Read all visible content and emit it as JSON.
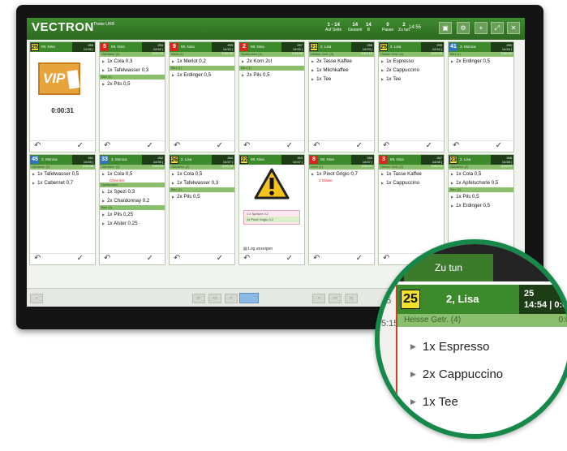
{
  "topbar": {
    "brand": "VECTRON",
    "brand_sub": "Theke\nUHR",
    "stats": [
      {
        "value": "1 - 14",
        "label": "Auf Seite"
      },
      {
        "value": "14",
        "label": "Gesamt"
      },
      {
        "value": "14",
        "label": "B"
      },
      {
        "value": "0",
        "label": "Pause"
      },
      {
        "value": "2",
        "label": "Zu tun"
      }
    ],
    "clock": "14:55"
  },
  "vip": {
    "badge": "VIP",
    "timer": "0:00:31"
  },
  "alert": {
    "messages": [
      "1 x Spritzer 0,2",
      "1x Pinot Grigio 0,2"
    ],
    "log_button": "Log anzeigen"
  },
  "tickets": [
    {
      "number": "25",
      "color": "y",
      "name": "Mt. Nina",
      "info1": "265",
      "info2": "14:56 | 0:00:31",
      "type": "vip"
    },
    {
      "number": "5",
      "color": "r",
      "name": "Mt. Nina",
      "info1": "254",
      "info2": "14:52 | 0:02:23",
      "groups": [
        {
          "label": "Getränke (2)",
          "items": [
            "1x Cola 0,3",
            "1x Tafelwasser 0,3"
          ]
        },
        {
          "label": "Bier (1)",
          "items": [
            "2x Pils 0,5"
          ]
        }
      ]
    },
    {
      "number": "9",
      "color": "r",
      "name": "Mt. Nina",
      "info1": "255",
      "info2": "14:52 | 0:02:08",
      "groups": [
        {
          "label": "Wein (1)",
          "items": [
            "1x Merlot 0,2"
          ]
        },
        {
          "label": "Bier (1)",
          "items": [
            "1x Erdinger 0,5"
          ]
        }
      ]
    },
    {
      "number": "2",
      "color": "r",
      "name": "Mt. Nina",
      "info1": "257",
      "info2": "14:53 | 0:01:46",
      "groups": [
        {
          "label": "Spirituosen (1)",
          "items": [
            "2x Korn 2cl"
          ]
        },
        {
          "label": "Bier (1)",
          "items": [
            "2x Pils 0,5"
          ]
        }
      ]
    },
    {
      "number": "21",
      "color": "y",
      "name": "2. Lisa",
      "info1": "258",
      "info2": "14:53 | 0:01:15",
      "groups": [
        {
          "label": "Heisse Getr. (4)",
          "items": [
            "2x Tasse Kaffee",
            "1x Milchkaffee",
            "1x Tee"
          ]
        }
      ]
    },
    {
      "number": "25",
      "color": "y",
      "name": "2. Lisa",
      "info1": "259",
      "info2": "14:54 | 0:00:55",
      "groups": [
        {
          "label": "Heisse Getr. (4)",
          "items": [
            "1x Espresso",
            "2x Cappuccino",
            "1x Tee"
          ]
        }
      ]
    },
    {
      "number": "41",
      "color": "b",
      "name": "3. Monica",
      "info1": "260",
      "info2": "14:54 | 0:00:44",
      "groups": [
        {
          "label": "Bier (1)",
          "items": [
            "2x Erdinger 0,5"
          ]
        }
      ]
    },
    {
      "number": "45",
      "color": "b",
      "name": "3. Monica",
      "info1": "261",
      "info2": "14:55 | 0:00:38",
      "groups": [
        {
          "label": "Getränke (2)",
          "items": [
            "1x Tafelwasser 0,5",
            "1x Cabernet 0,7"
          ]
        }
      ]
    },
    {
      "number": "33",
      "color": "b",
      "name": "3. Monica",
      "info1": "262",
      "info2": "14:55 | 0:00:34",
      "groups": [
        {
          "label": "Getränke (2)",
          "items": [
            "1x Cola 0,5"
          ],
          "note": "Ohne Eis"
        },
        {
          "label": "Spirituosen",
          "items": [
            "1x Spezi 0,3",
            "2x Chardonnay 0,2"
          ]
        },
        {
          "label": "Bier (2)",
          "items": [
            "1x Pils 0,25",
            "1x Alster 0,25"
          ]
        }
      ]
    },
    {
      "number": "26",
      "color": "y",
      "name": "2. Lisa",
      "info1": "264",
      "info2": "14:57 | 0:00:28",
      "groups": [
        {
          "label": "Getränke (2)",
          "items": [
            "1x Cola 0,5",
            "1x Tafelwasser 0,3"
          ]
        },
        {
          "label": "Bier (1)",
          "items": [
            "2x Pils 0,5"
          ]
        }
      ]
    },
    {
      "number": "22",
      "color": "y",
      "name": "Mt. Nina",
      "info1": "263",
      "info2": "14:57 | 0:00:23",
      "type": "alert"
    },
    {
      "number": "8",
      "color": "r",
      "name": "Mt. Nina",
      "info1": "266",
      "info2": "14:57 | 0:00:21",
      "groups": [
        {
          "label": "Wein (1)",
          "items": [
            "1x Pinot Grigio 0,7"
          ],
          "note": "2 Gläser"
        }
      ]
    },
    {
      "number": "3",
      "color": "r",
      "name": "Mt. Nina",
      "info1": "267",
      "info2": "14:58 | 0:00:14",
      "groups": [
        {
          "label": "Heisse Getr. (2)",
          "items": [
            "1x Tasse Kaffee",
            "1x Cappuccino"
          ]
        }
      ]
    },
    {
      "number": "23",
      "color": "y",
      "name": "2. Lisa",
      "info1": "268",
      "info2": "14:58 | 0:00:09",
      "groups": [
        {
          "label": "Getränke (2)",
          "items": [
            "1x Cola 0,5",
            "1x Apfelschorle 0,5"
          ]
        },
        {
          "label": "Bier (2)",
          "items": [
            "1x Pils 0,5",
            "1x Erdinger 0,5"
          ]
        }
      ]
    }
  ],
  "zoom": {
    "tab": "Zu tun",
    "left_numbers": [
      "15",
      "5:15"
    ],
    "number": "25",
    "name": "2, Lisa",
    "info1": "25",
    "info2": "14:54 | 0:0",
    "group": "Heisse Getr. (4)",
    "group_right": "0:05",
    "items": [
      "1x Espresso",
      "2x Cappuccino",
      "1x Tee"
    ]
  }
}
